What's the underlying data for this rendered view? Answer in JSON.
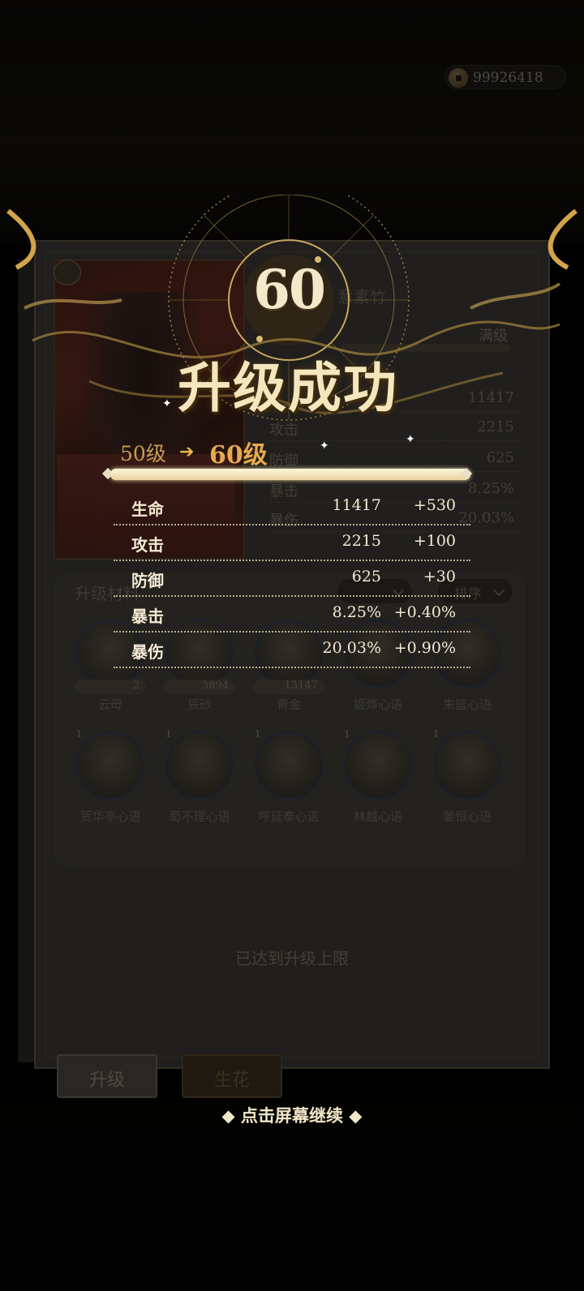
{
  "header": {
    "currency_value": "99926418"
  },
  "background_panel": {
    "title": "意素竹",
    "level_label": "满级",
    "stats": [
      {
        "label": "攻击",
        "value": "2215"
      },
      {
        "label": "防御",
        "value": "625"
      },
      {
        "label": "暴击",
        "value": "8.25%"
      },
      {
        "label": "暴伤",
        "value": "20.03%"
      }
    ],
    "partial_value": "11417",
    "materials_title": "升级材料",
    "sort_button": "排序",
    "materials": [
      {
        "name": "云母",
        "count": "2"
      },
      {
        "name": "辰砂",
        "count": "3894"
      },
      {
        "name": "青金",
        "count": "13147"
      },
      {
        "name": "姬烨心语",
        "count": ""
      },
      {
        "name": "朱篮心语",
        "count": ""
      },
      {
        "name": "贺华亭心语",
        "count": "1"
      },
      {
        "name": "荀不理心语",
        "count": "1"
      },
      {
        "name": "呼延泰心语",
        "count": "1"
      },
      {
        "name": "林越心语",
        "count": "1"
      },
      {
        "name": "姜恒心语",
        "count": "1"
      }
    ],
    "limit_text": "已达到升级上限",
    "tabs": [
      {
        "label": "升级"
      },
      {
        "label": "生花"
      }
    ]
  },
  "levelup": {
    "level_number": "60",
    "title": "升级成功",
    "from_level": "50级",
    "to_level": "60级",
    "progress_fraction": 1.0,
    "stats": [
      {
        "label": "生命",
        "value": "11417",
        "increase": "+530"
      },
      {
        "label": "攻击",
        "value": "2215",
        "increase": "+100"
      },
      {
        "label": "防御",
        "value": "625",
        "increase": "+30"
      },
      {
        "label": "暴击",
        "value": "8.25%",
        "increase": "+0.40%"
      },
      {
        "label": "暴伤",
        "value": "20.03%",
        "increase": "+0.90%"
      }
    ],
    "continue_text": "◆ 点击屏幕继续 ◆"
  },
  "colors": {
    "gold": "#e8a94e",
    "cream": "#f5e7bd",
    "panel": "#3b3a35"
  }
}
